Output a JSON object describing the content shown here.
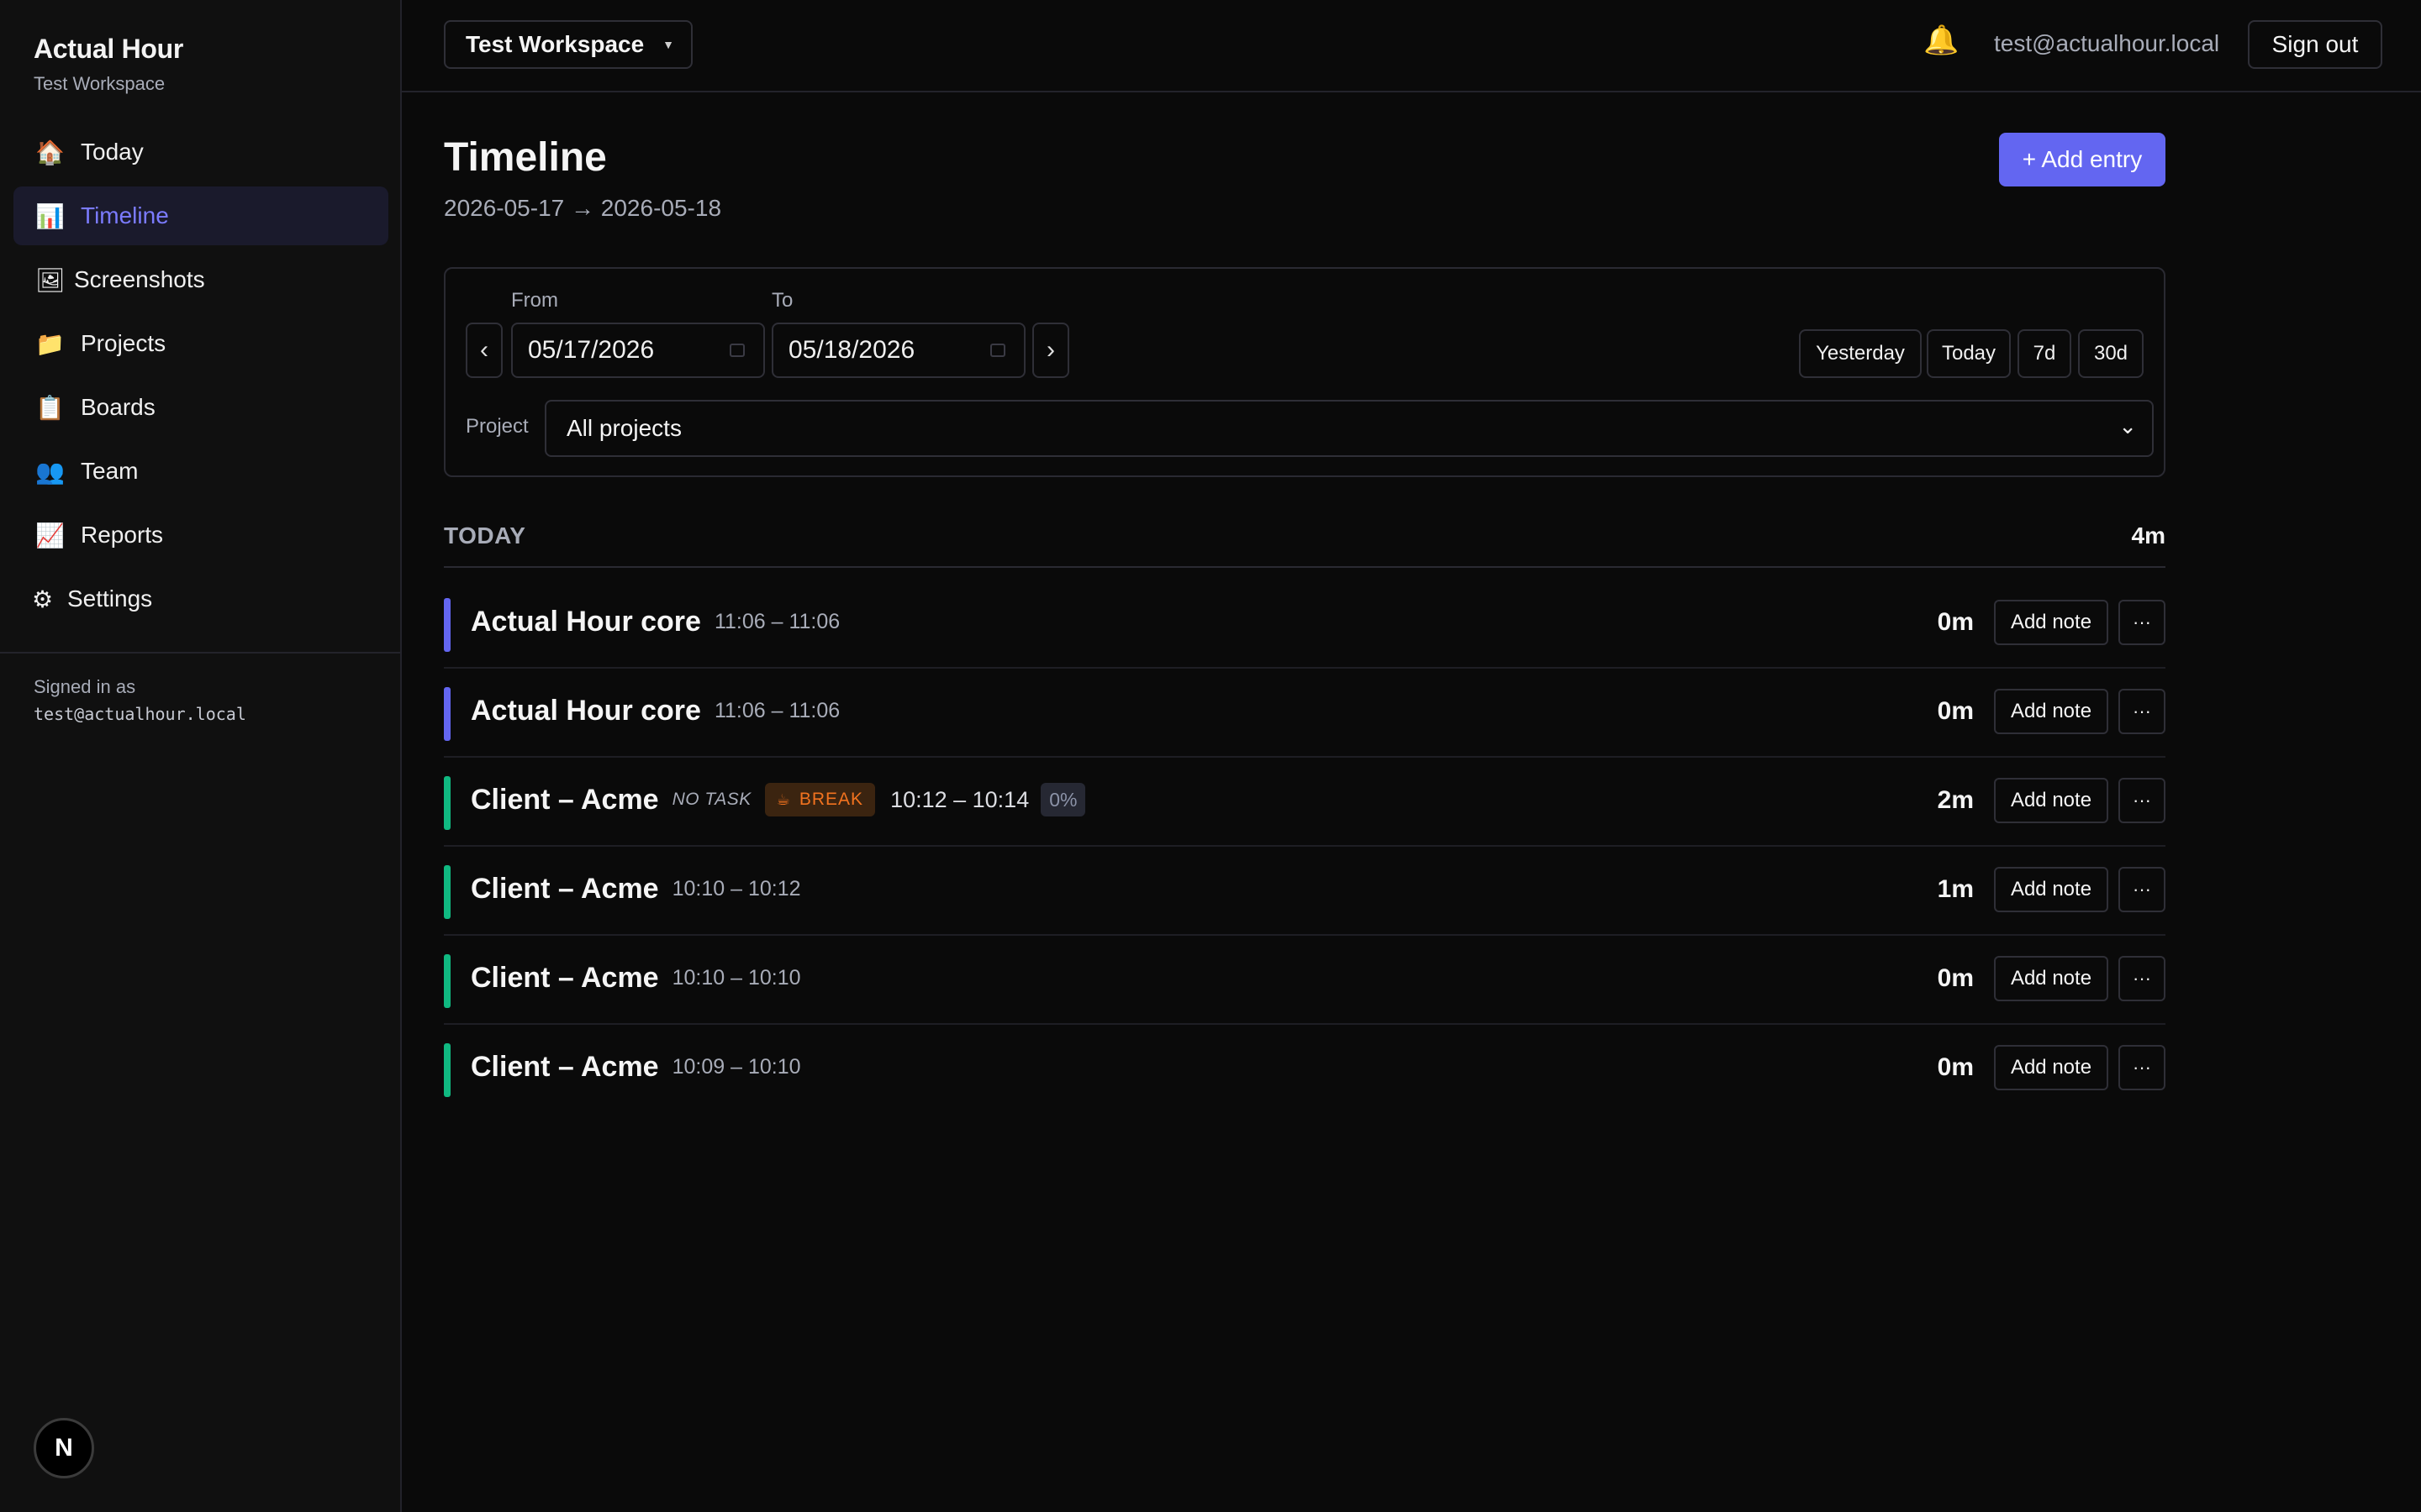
{
  "app": {
    "name": "Actual Hour",
    "workspace": "Test Workspace"
  },
  "sidebar": {
    "items": [
      {
        "label": "Today",
        "icon": "house-icon",
        "glyph": "🏠"
      },
      {
        "label": "Timeline",
        "icon": "bar-chart-icon",
        "glyph": "📊",
        "active": true
      },
      {
        "label": "Screenshots",
        "icon": "framed-picture-icon",
        "glyph": "🖼"
      },
      {
        "label": "Projects",
        "icon": "folder-icon",
        "glyph": "📁"
      },
      {
        "label": "Boards",
        "icon": "clipboard-icon",
        "glyph": "📋"
      },
      {
        "label": "Team",
        "icon": "people-icon",
        "glyph": "👥"
      },
      {
        "label": "Reports",
        "icon": "trend-chart-icon",
        "glyph": "📈"
      },
      {
        "label": "Settings",
        "icon": "gear-icon",
        "glyph": "⚙"
      }
    ],
    "signed_in_label": "Signed in as",
    "signed_in_email": "test@actualhour.local",
    "badge_letter": "N"
  },
  "topbar": {
    "workspace_select": "Test Workspace",
    "user_email": "test@actualhour.local",
    "sign_out": "Sign out"
  },
  "main": {
    "title": "Timeline",
    "date_range": "2026-05-17 → 2026-05-18",
    "add_entry": "+ Add entry",
    "filters": {
      "from_label": "From",
      "to_label": "To",
      "from_value": "05/17/2026",
      "to_value": "05/18/2026",
      "prev": "‹",
      "next": "›",
      "quick": [
        "Yesterday",
        "Today",
        "7d",
        "30d"
      ],
      "project_label": "Project",
      "project_value": "All projects"
    },
    "day": {
      "label": "TODAY",
      "total": "4m"
    },
    "entries": [
      {
        "title": "Actual Hour core",
        "time": "11:06 – 11:06",
        "duration": "0m",
        "color": "#6366f1"
      },
      {
        "title": "Actual Hour core",
        "time": "11:06 – 11:06",
        "duration": "0m",
        "color": "#6366f1"
      },
      {
        "title": "Client – Acme",
        "no_task": "NO TASK",
        "badge": "BREAK",
        "time": "10:12 – 10:14",
        "percent": "0%",
        "duration": "2m",
        "color": "#10b981"
      },
      {
        "title": "Client – Acme",
        "time": "10:10 – 10:12",
        "duration": "1m",
        "color": "#10b981"
      },
      {
        "title": "Client – Acme",
        "time": "10:10 – 10:10",
        "duration": "0m",
        "color": "#10b981"
      },
      {
        "title": "Client – Acme",
        "time": "10:09 – 10:10",
        "duration": "0m",
        "color": "#10b981"
      }
    ],
    "add_note_label": "Add note",
    "more_label": "···"
  },
  "colors": {
    "accent": "#6366f1",
    "active_nav": "#7b7bff",
    "break_text": "#f2731f",
    "acme_bar": "#10b981",
    "core_bar": "#6366f1"
  }
}
